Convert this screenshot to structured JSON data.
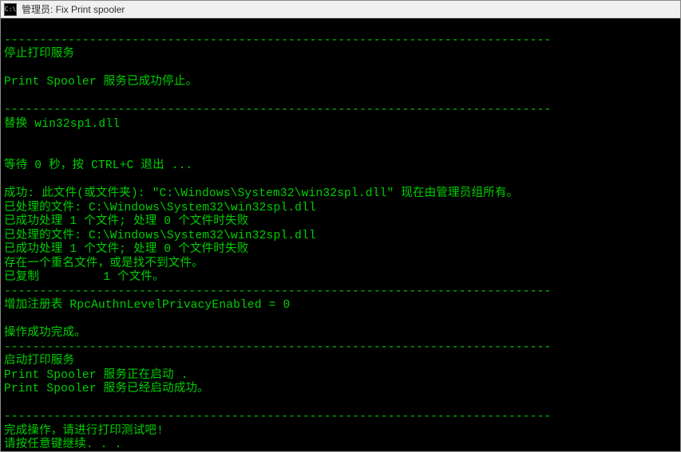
{
  "titlebar": {
    "icon_text": "C:\\",
    "title": "管理员:  Fix Print spooler"
  },
  "console": {
    "lines": [
      "",
      "-----------------------------------------------------------------------------",
      "停止打印服务",
      "",
      "Print Spooler 服务已成功停止。",
      "",
      "-----------------------------------------------------------------------------",
      "替换 win32sp1.dll",
      "",
      "",
      "等待 0 秒，按 CTRL+C 退出 ...",
      "",
      "成功: 此文件(或文件夹): \"C:\\Windows\\System32\\win32spl.dll\" 现在由管理员组所有。",
      "已处理的文件: C:\\Windows\\System32\\win32spl.dll",
      "已成功处理 1 个文件; 处理 0 个文件时失败",
      "已处理的文件: C:\\Windows\\System32\\win32spl.dll",
      "已成功处理 1 个文件; 处理 0 个文件时失败",
      "存在一个重名文件，或是找不到文件。",
      "已复制         1 个文件。",
      "-----------------------------------------------------------------------------",
      "增加注册表 RpcAuthnLevelPrivacyEnabled = 0",
      "",
      "操作成功完成。",
      "-----------------------------------------------------------------------------",
      "启动打印服务",
      "Print Spooler 服务正在启动 .",
      "Print Spooler 服务已经启动成功。",
      "",
      "-----------------------------------------------------------------------------",
      "完成操作，请进行打印测试吧!",
      "请按任意键继续. . ."
    ]
  }
}
